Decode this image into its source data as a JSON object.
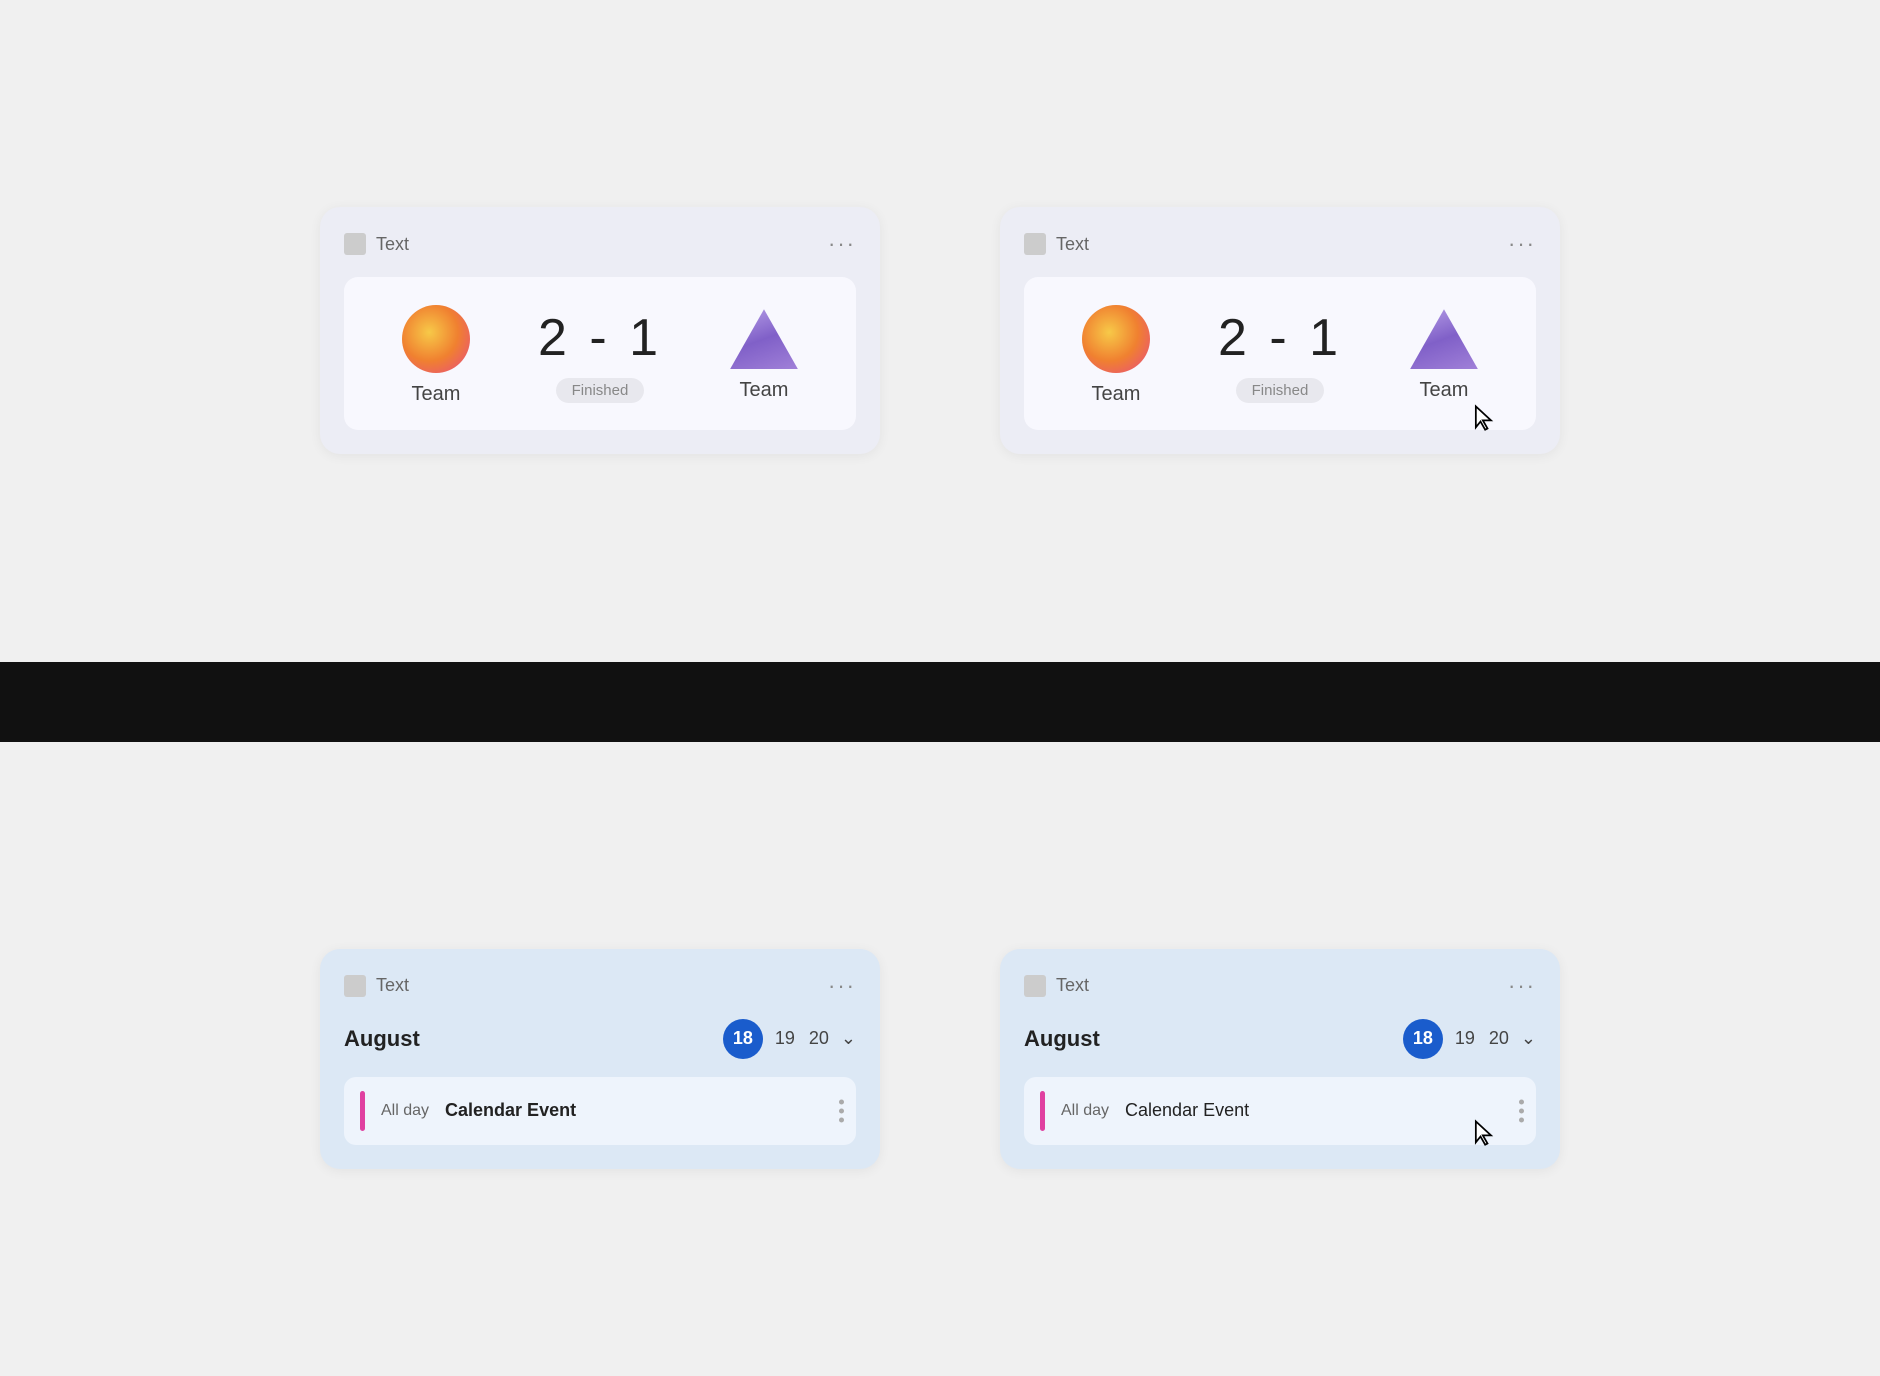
{
  "cards": {
    "score_card_1": {
      "header_text": "Text",
      "three_dots": "···",
      "team1_label": "Team",
      "team2_label": "Team",
      "score": "2 - 1",
      "status": "Finished"
    },
    "score_card_2": {
      "header_text": "Text",
      "three_dots": "···",
      "team1_label": "Team",
      "team2_label": "Team",
      "score": "2 - 1",
      "status": "Finished"
    },
    "calendar_card_1": {
      "header_text": "Text",
      "three_dots": "···",
      "month": "August",
      "date1": "18",
      "date2": "19",
      "date3": "20",
      "all_day": "All day",
      "event_title": "Calendar Event"
    },
    "calendar_card_2": {
      "header_text": "Text",
      "three_dots": "···",
      "month": "August",
      "date1": "18",
      "date2": "19",
      "date3": "20",
      "all_day": "All day",
      "event_title": "Calendar Event"
    }
  }
}
